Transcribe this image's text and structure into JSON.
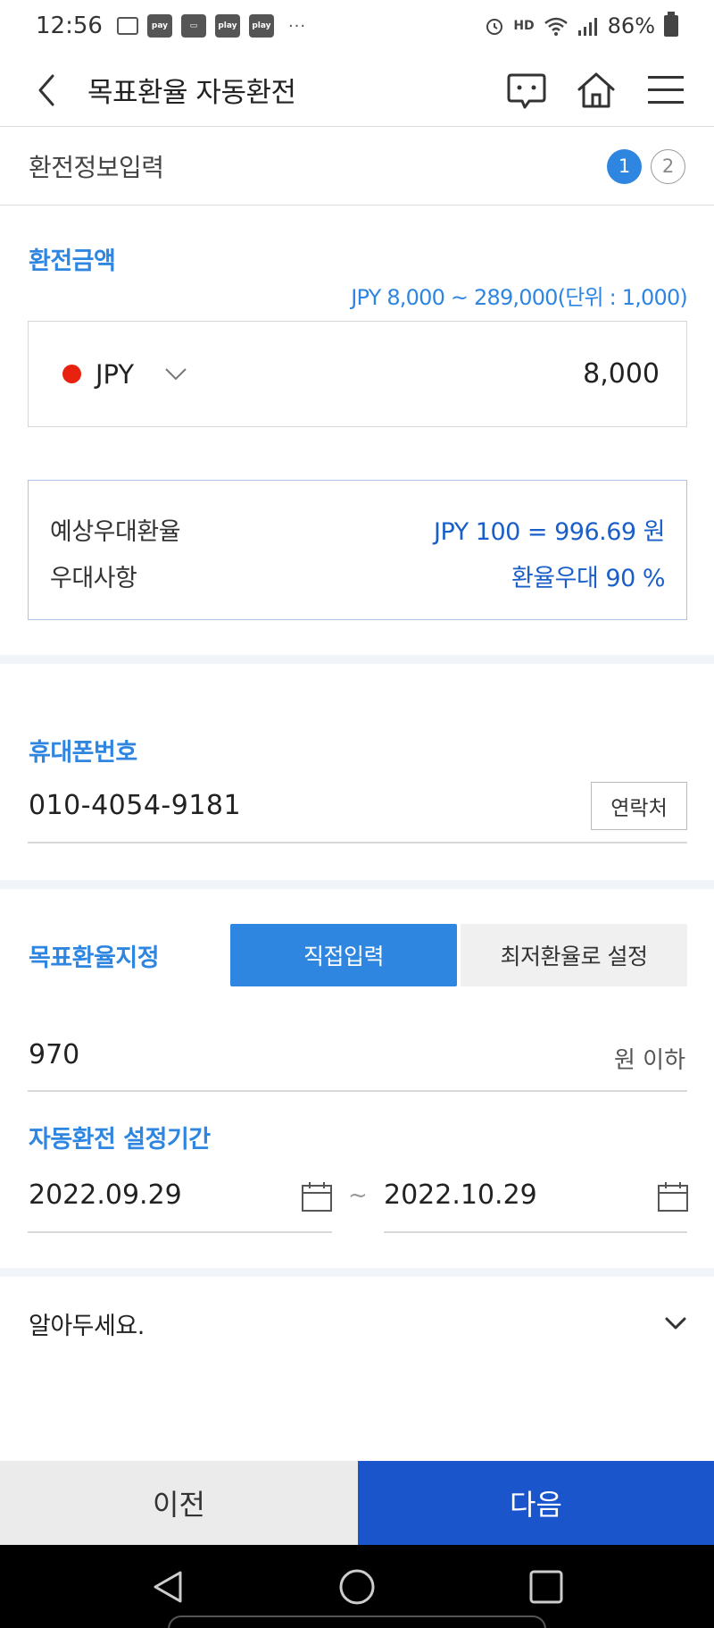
{
  "status_bar": {
    "time": "12:56",
    "notification_icons": [
      "message-icon",
      "pay-icon",
      "wallet-icon",
      "play-icon",
      "play-icon"
    ],
    "pay_label": "pay",
    "play_label": "play",
    "more": "···",
    "hd": "HD",
    "battery": "86%"
  },
  "header": {
    "title": "목표환율 자동환전",
    "icons": [
      "back-icon",
      "chat-icon",
      "home-icon",
      "menu-icon"
    ]
  },
  "steps": {
    "label": "환전정보입력",
    "items": [
      "1",
      "2"
    ],
    "current": 1
  },
  "exchange": {
    "section_title": "환전금액",
    "range": "JPY 8,000 ~ 289,000(단위 : 1,000)",
    "currency": "JPY",
    "currency_color": "#e8220f",
    "amount": "8,000",
    "expected_rate_label": "예상우대환율",
    "expected_rate_value": "JPY 100 = 996.69 원",
    "benefit_label": "우대사항",
    "benefit_value": "환율우대 90 %"
  },
  "phone": {
    "section_title": "휴대폰번호",
    "value": "010-4054-9181",
    "contact_button": "연락처"
  },
  "target_rate": {
    "section_title": "목표환율지정",
    "options": [
      "직접입력",
      "최저환율로 설정"
    ],
    "selected": "직접입력",
    "value": "970",
    "unit": "원 이하"
  },
  "period": {
    "section_title": "자동환전 설정기간",
    "start": "2022.09.29",
    "separator": "~",
    "end": "2022.10.29"
  },
  "notice": {
    "title": "알아두세요."
  },
  "footer": {
    "prev": "이전",
    "next": "다음"
  },
  "colors": {
    "accent": "#2f86e0",
    "primary_button": "#1a55cc",
    "info_text": "#1a5fc8"
  }
}
